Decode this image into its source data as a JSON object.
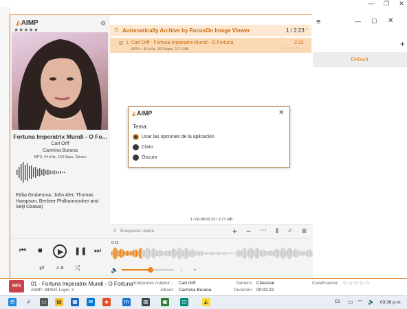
{
  "background_app": {
    "window_controls": [
      "—",
      "❐",
      "✕"
    ],
    "right_panel": {
      "default_label": "Default",
      "plus_icon": "+"
    }
  },
  "player": {
    "logo": "AIMP",
    "rating_stars": "★★★★★",
    "track_title": "Fortuna Imperatrix Mundi - O Fo...",
    "artist": "Carl Orff",
    "album": "Carmina Burana",
    "format": "MP3, 44 kHz, 160 kbps, Stereo",
    "performers": "Edita Gruberova, John Aler, Thomas Hampson, Berliner Philharmoniker and Seiji Ozawa)"
  },
  "playlist": {
    "header_title": "Automatically Archive by FocusOn Image Viewer",
    "header_counter": "1 / 2:23",
    "rows": [
      {
        "number": "1.",
        "title": "Carl Orff - Fortuna Imperatrix Mundi - O Fortuna",
        "duration": "2:23",
        "details": "MP3 :: 44 kHz, 160 kbps, 2,71 MB",
        "rating": "○ ○ ○ ○ ○"
      }
    ],
    "summary": "1 / 00:00:02:23 / 2,71 MB",
    "search_placeholder": "Búsqueda rápida"
  },
  "controls": {
    "time_elapsed": "0:21",
    "ab_label": "A-B",
    "volume_level": 0.55,
    "seek_position": 0.15
  },
  "dialog": {
    "logo": "AIMP",
    "heading": "Tema:",
    "options": [
      {
        "label": "Usar las opciones de la aplicación",
        "selected": true
      },
      {
        "label": "Claro",
        "selected": false
      },
      {
        "label": "Oscuro",
        "selected": false
      }
    ]
  },
  "info_strip": {
    "badge": "MP3",
    "track": "01 - Fortuna Imperatrix Mundi - O Fortuna",
    "codec": "AIMP: MPEG Layer 3",
    "performers_label": "Intérpretes colabor...",
    "performers_value": "Carl Orff",
    "album_label": "Álbum:",
    "album_value": "Carmina Burana",
    "genre_label": "Género:",
    "genre_value": "Classical",
    "duration_label": "Duración:",
    "duration_value": "00:02:22",
    "rating_label": "Clasificación:",
    "rating_value": "☆☆☆☆☆"
  },
  "taskbar": {
    "language": "ES",
    "clock": "03:36 p.m."
  },
  "colors": {
    "accent": "#e8841a",
    "header_bg": "#fde9d3",
    "row_bg": "#fbd9b5",
    "badge": "#c8434a"
  }
}
